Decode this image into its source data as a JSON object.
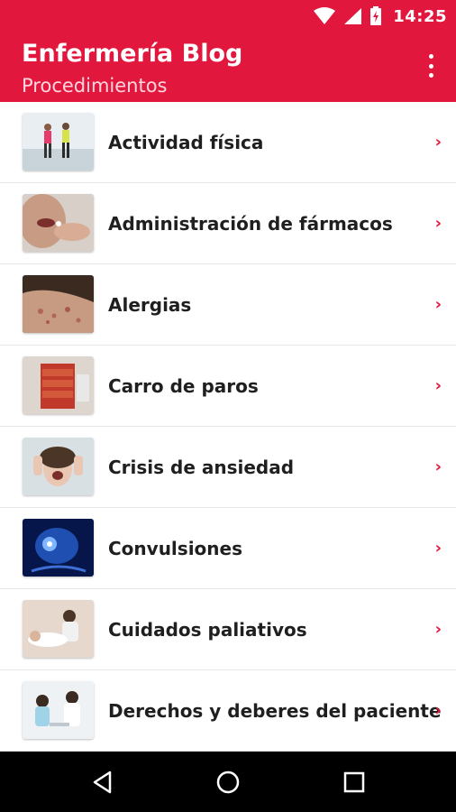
{
  "status_bar": {
    "time": "14:25",
    "icons": [
      "wifi-icon",
      "signal-icon",
      "battery-icon"
    ]
  },
  "app_bar": {
    "title": "Enfermería Blog",
    "subtitle": "Procedimientos",
    "overflow_icon": "more-vert-icon",
    "color": "#e2173d"
  },
  "list": {
    "items": [
      {
        "label": "Actividad física",
        "thumbnail": "running-people-photo"
      },
      {
        "label": "Administración de fármacos",
        "thumbnail": "pill-mouth-photo"
      },
      {
        "label": "Alergias",
        "thumbnail": "skin-rash-photo"
      },
      {
        "label": "Carro de paros",
        "thumbnail": "crash-cart-photo"
      },
      {
        "label": "Crisis de ansiedad",
        "thumbnail": "screaming-woman-photo"
      },
      {
        "label": "Convulsiones",
        "thumbnail": "brain-scan-photo"
      },
      {
        "label": "Cuidados paliativos",
        "thumbnail": "caregiver-patient-photo"
      },
      {
        "label": "Derechos y deberes del paciente",
        "thumbnail": "doctor-patient-photo"
      }
    ],
    "chevron": "›"
  },
  "nav_bar": {
    "buttons": [
      "back-icon",
      "home-icon",
      "recents-icon"
    ]
  }
}
